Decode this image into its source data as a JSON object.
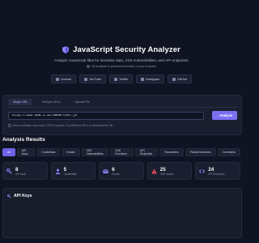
{
  "header": {
    "title": "JavaScript Security Analyzer",
    "subtitle": "Analyze JavaScript files for sensitive data, XSS vulnerabilities, and API endpoints",
    "note": "All analysis is performed locally in your browser"
  },
  "social": [
    {
      "label": "License",
      "icon": "license-icon"
    },
    {
      "label": "YouTube",
      "icon": "youtube-icon"
    },
    {
      "label": "Twitter",
      "icon": "twitter-icon"
    },
    {
      "label": "Instagram",
      "icon": "instagram-icon"
    },
    {
      "label": "GitHub",
      "icon": "github-icon"
    }
  ],
  "input": {
    "tabs": [
      "Single URL",
      "Multiple URLs",
      "Upload File"
    ],
    "active_tab": 0,
    "url_value": "http://192.168.1.12:5000/test.js",
    "analyze_label": "Analyze",
    "hint": "Some websites may block CORS requests. Try different URLs or download the file."
  },
  "results": {
    "title": "Analysis Results",
    "filters": [
      "All",
      "API Keys",
      "Credentials",
      "Emails",
      "XSS Vulnerabilities",
      "XSS Functions",
      "API Endpoints",
      "Parameters",
      "Paths/Directories",
      "Comments"
    ],
    "active_filter": 0,
    "stats": [
      {
        "value": "8",
        "label": "API Keys",
        "icon": "key-icon",
        "color": "#8f83ff"
      },
      {
        "value": "5",
        "label": "Credentials",
        "icon": "user-icon",
        "color": "#8f83ff"
      },
      {
        "value": "6",
        "label": "Emails",
        "icon": "envelope-icon",
        "color": "#8f83ff"
      },
      {
        "value": "25",
        "label": "XSS Issues",
        "icon": "warning-icon",
        "color": "#ef4b5b"
      },
      {
        "value": "24",
        "label": "API Endpoints",
        "icon": "code-icon",
        "color": "#8f83ff"
      }
    ],
    "section_title": "API Keys"
  },
  "colors": {
    "accent": "#7b6ff2",
    "background": "#0f1322",
    "danger": "#ef4b5b"
  }
}
